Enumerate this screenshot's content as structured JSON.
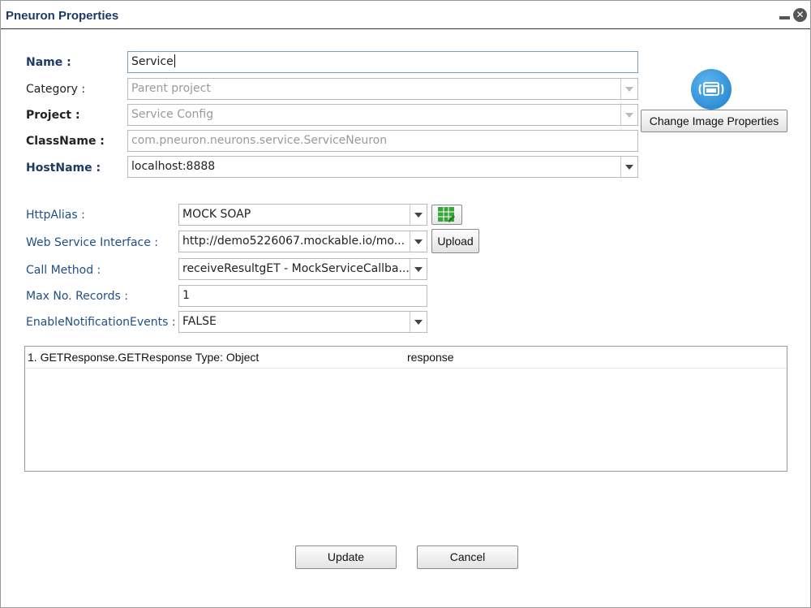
{
  "window": {
    "title": "Pneuron Properties",
    "minimize_icon": "minimize-icon",
    "close_icon": "close-icon",
    "close_glyph": "✕"
  },
  "form": {
    "name": {
      "label": "Name :",
      "value": "Service"
    },
    "category": {
      "label": "Category :",
      "value": "Parent project"
    },
    "project": {
      "label": "Project :",
      "value": "Service Config"
    },
    "classname": {
      "label": "ClassName :",
      "value": "com.pneuron.neurons.service.ServiceNeuron"
    },
    "hostname": {
      "label": "HostName :",
      "value": "localhost:8888"
    }
  },
  "image": {
    "icon": "service-image-icon",
    "button_label": "Change Image Properties"
  },
  "settings": {
    "http_alias": {
      "label": "HttpAlias :",
      "value": "MOCK SOAP",
      "grid_icon": "grid-edit-icon"
    },
    "web_service_interface": {
      "label": "Web Service Interface :",
      "value": "http://demo5226067.mockable.io/mo...",
      "upload_label": "Upload"
    },
    "call_method": {
      "label": "Call Method :",
      "value": "receiveResultgET - MockServiceCallba..."
    },
    "max_records": {
      "label": "Max No. Records :",
      "value": "1"
    },
    "enable_notification_events": {
      "label": "EnableNotificationEvents :",
      "value": "FALSE"
    }
  },
  "results": {
    "rows": [
      {
        "name": "1. GETResponse.GETResponse Type: Object",
        "value": "response"
      }
    ]
  },
  "footer": {
    "update_label": "Update",
    "cancel_label": "Cancel"
  },
  "colors": {
    "title": "#1d3a66",
    "label_blue": "#1f4f86",
    "accent_icon": "#1a7fcc",
    "grid_icon": "#3aa53a"
  }
}
